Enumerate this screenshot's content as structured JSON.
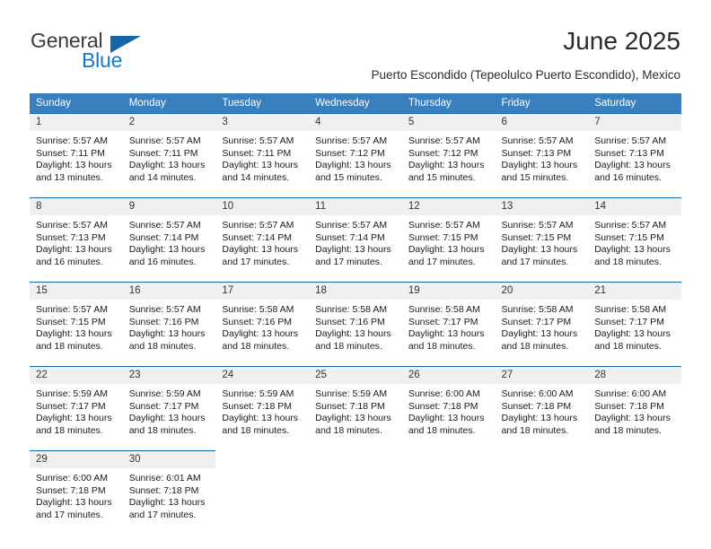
{
  "brand": {
    "name_part1": "General",
    "name_part2": "Blue",
    "triangle_icon": "triangle-logo-icon",
    "accent_color": "#1579c4"
  },
  "header": {
    "title": "June 2025",
    "subtitle": "Puerto Escondido (Tepeolulco Puerto Escondido), Mexico"
  },
  "calendar": {
    "header_bg_color": "#3a7fbd",
    "daynum_bg_color": "#f0f0f0",
    "row_divider_color": "#1565a8",
    "weekday_headers": [
      "Sunday",
      "Monday",
      "Tuesday",
      "Wednesday",
      "Thursday",
      "Friday",
      "Saturday"
    ],
    "weeks": [
      [
        {
          "day": "1",
          "sunrise": "Sunrise: 5:57 AM",
          "sunset": "Sunset: 7:11 PM",
          "daylight": "Daylight: 13 hours and 13 minutes."
        },
        {
          "day": "2",
          "sunrise": "Sunrise: 5:57 AM",
          "sunset": "Sunset: 7:11 PM",
          "daylight": "Daylight: 13 hours and 14 minutes."
        },
        {
          "day": "3",
          "sunrise": "Sunrise: 5:57 AM",
          "sunset": "Sunset: 7:11 PM",
          "daylight": "Daylight: 13 hours and 14 minutes."
        },
        {
          "day": "4",
          "sunrise": "Sunrise: 5:57 AM",
          "sunset": "Sunset: 7:12 PM",
          "daylight": "Daylight: 13 hours and 15 minutes."
        },
        {
          "day": "5",
          "sunrise": "Sunrise: 5:57 AM",
          "sunset": "Sunset: 7:12 PM",
          "daylight": "Daylight: 13 hours and 15 minutes."
        },
        {
          "day": "6",
          "sunrise": "Sunrise: 5:57 AM",
          "sunset": "Sunset: 7:13 PM",
          "daylight": "Daylight: 13 hours and 15 minutes."
        },
        {
          "day": "7",
          "sunrise": "Sunrise: 5:57 AM",
          "sunset": "Sunset: 7:13 PM",
          "daylight": "Daylight: 13 hours and 16 minutes."
        }
      ],
      [
        {
          "day": "8",
          "sunrise": "Sunrise: 5:57 AM",
          "sunset": "Sunset: 7:13 PM",
          "daylight": "Daylight: 13 hours and 16 minutes."
        },
        {
          "day": "9",
          "sunrise": "Sunrise: 5:57 AM",
          "sunset": "Sunset: 7:14 PM",
          "daylight": "Daylight: 13 hours and 16 minutes."
        },
        {
          "day": "10",
          "sunrise": "Sunrise: 5:57 AM",
          "sunset": "Sunset: 7:14 PM",
          "daylight": "Daylight: 13 hours and 17 minutes."
        },
        {
          "day": "11",
          "sunrise": "Sunrise: 5:57 AM",
          "sunset": "Sunset: 7:14 PM",
          "daylight": "Daylight: 13 hours and 17 minutes."
        },
        {
          "day": "12",
          "sunrise": "Sunrise: 5:57 AM",
          "sunset": "Sunset: 7:15 PM",
          "daylight": "Daylight: 13 hours and 17 minutes."
        },
        {
          "day": "13",
          "sunrise": "Sunrise: 5:57 AM",
          "sunset": "Sunset: 7:15 PM",
          "daylight": "Daylight: 13 hours and 17 minutes."
        },
        {
          "day": "14",
          "sunrise": "Sunrise: 5:57 AM",
          "sunset": "Sunset: 7:15 PM",
          "daylight": "Daylight: 13 hours and 18 minutes."
        }
      ],
      [
        {
          "day": "15",
          "sunrise": "Sunrise: 5:57 AM",
          "sunset": "Sunset: 7:15 PM",
          "daylight": "Daylight: 13 hours and 18 minutes."
        },
        {
          "day": "16",
          "sunrise": "Sunrise: 5:57 AM",
          "sunset": "Sunset: 7:16 PM",
          "daylight": "Daylight: 13 hours and 18 minutes."
        },
        {
          "day": "17",
          "sunrise": "Sunrise: 5:58 AM",
          "sunset": "Sunset: 7:16 PM",
          "daylight": "Daylight: 13 hours and 18 minutes."
        },
        {
          "day": "18",
          "sunrise": "Sunrise: 5:58 AM",
          "sunset": "Sunset: 7:16 PM",
          "daylight": "Daylight: 13 hours and 18 minutes."
        },
        {
          "day": "19",
          "sunrise": "Sunrise: 5:58 AM",
          "sunset": "Sunset: 7:17 PM",
          "daylight": "Daylight: 13 hours and 18 minutes."
        },
        {
          "day": "20",
          "sunrise": "Sunrise: 5:58 AM",
          "sunset": "Sunset: 7:17 PM",
          "daylight": "Daylight: 13 hours and 18 minutes."
        },
        {
          "day": "21",
          "sunrise": "Sunrise: 5:58 AM",
          "sunset": "Sunset: 7:17 PM",
          "daylight": "Daylight: 13 hours and 18 minutes."
        }
      ],
      [
        {
          "day": "22",
          "sunrise": "Sunrise: 5:59 AM",
          "sunset": "Sunset: 7:17 PM",
          "daylight": "Daylight: 13 hours and 18 minutes."
        },
        {
          "day": "23",
          "sunrise": "Sunrise: 5:59 AM",
          "sunset": "Sunset: 7:17 PM",
          "daylight": "Daylight: 13 hours and 18 minutes."
        },
        {
          "day": "24",
          "sunrise": "Sunrise: 5:59 AM",
          "sunset": "Sunset: 7:18 PM",
          "daylight": "Daylight: 13 hours and 18 minutes."
        },
        {
          "day": "25",
          "sunrise": "Sunrise: 5:59 AM",
          "sunset": "Sunset: 7:18 PM",
          "daylight": "Daylight: 13 hours and 18 minutes."
        },
        {
          "day": "26",
          "sunrise": "Sunrise: 6:00 AM",
          "sunset": "Sunset: 7:18 PM",
          "daylight": "Daylight: 13 hours and 18 minutes."
        },
        {
          "day": "27",
          "sunrise": "Sunrise: 6:00 AM",
          "sunset": "Sunset: 7:18 PM",
          "daylight": "Daylight: 13 hours and 18 minutes."
        },
        {
          "day": "28",
          "sunrise": "Sunrise: 6:00 AM",
          "sunset": "Sunset: 7:18 PM",
          "daylight": "Daylight: 13 hours and 18 minutes."
        }
      ],
      [
        {
          "day": "29",
          "sunrise": "Sunrise: 6:00 AM",
          "sunset": "Sunset: 7:18 PM",
          "daylight": "Daylight: 13 hours and 17 minutes."
        },
        {
          "day": "30",
          "sunrise": "Sunrise: 6:01 AM",
          "sunset": "Sunset: 7:18 PM",
          "daylight": "Daylight: 13 hours and 17 minutes."
        },
        {
          "day": "",
          "sunrise": "",
          "sunset": "",
          "daylight": ""
        },
        {
          "day": "",
          "sunrise": "",
          "sunset": "",
          "daylight": ""
        },
        {
          "day": "",
          "sunrise": "",
          "sunset": "",
          "daylight": ""
        },
        {
          "day": "",
          "sunrise": "",
          "sunset": "",
          "daylight": ""
        },
        {
          "day": "",
          "sunrise": "",
          "sunset": "",
          "daylight": ""
        }
      ]
    ]
  }
}
